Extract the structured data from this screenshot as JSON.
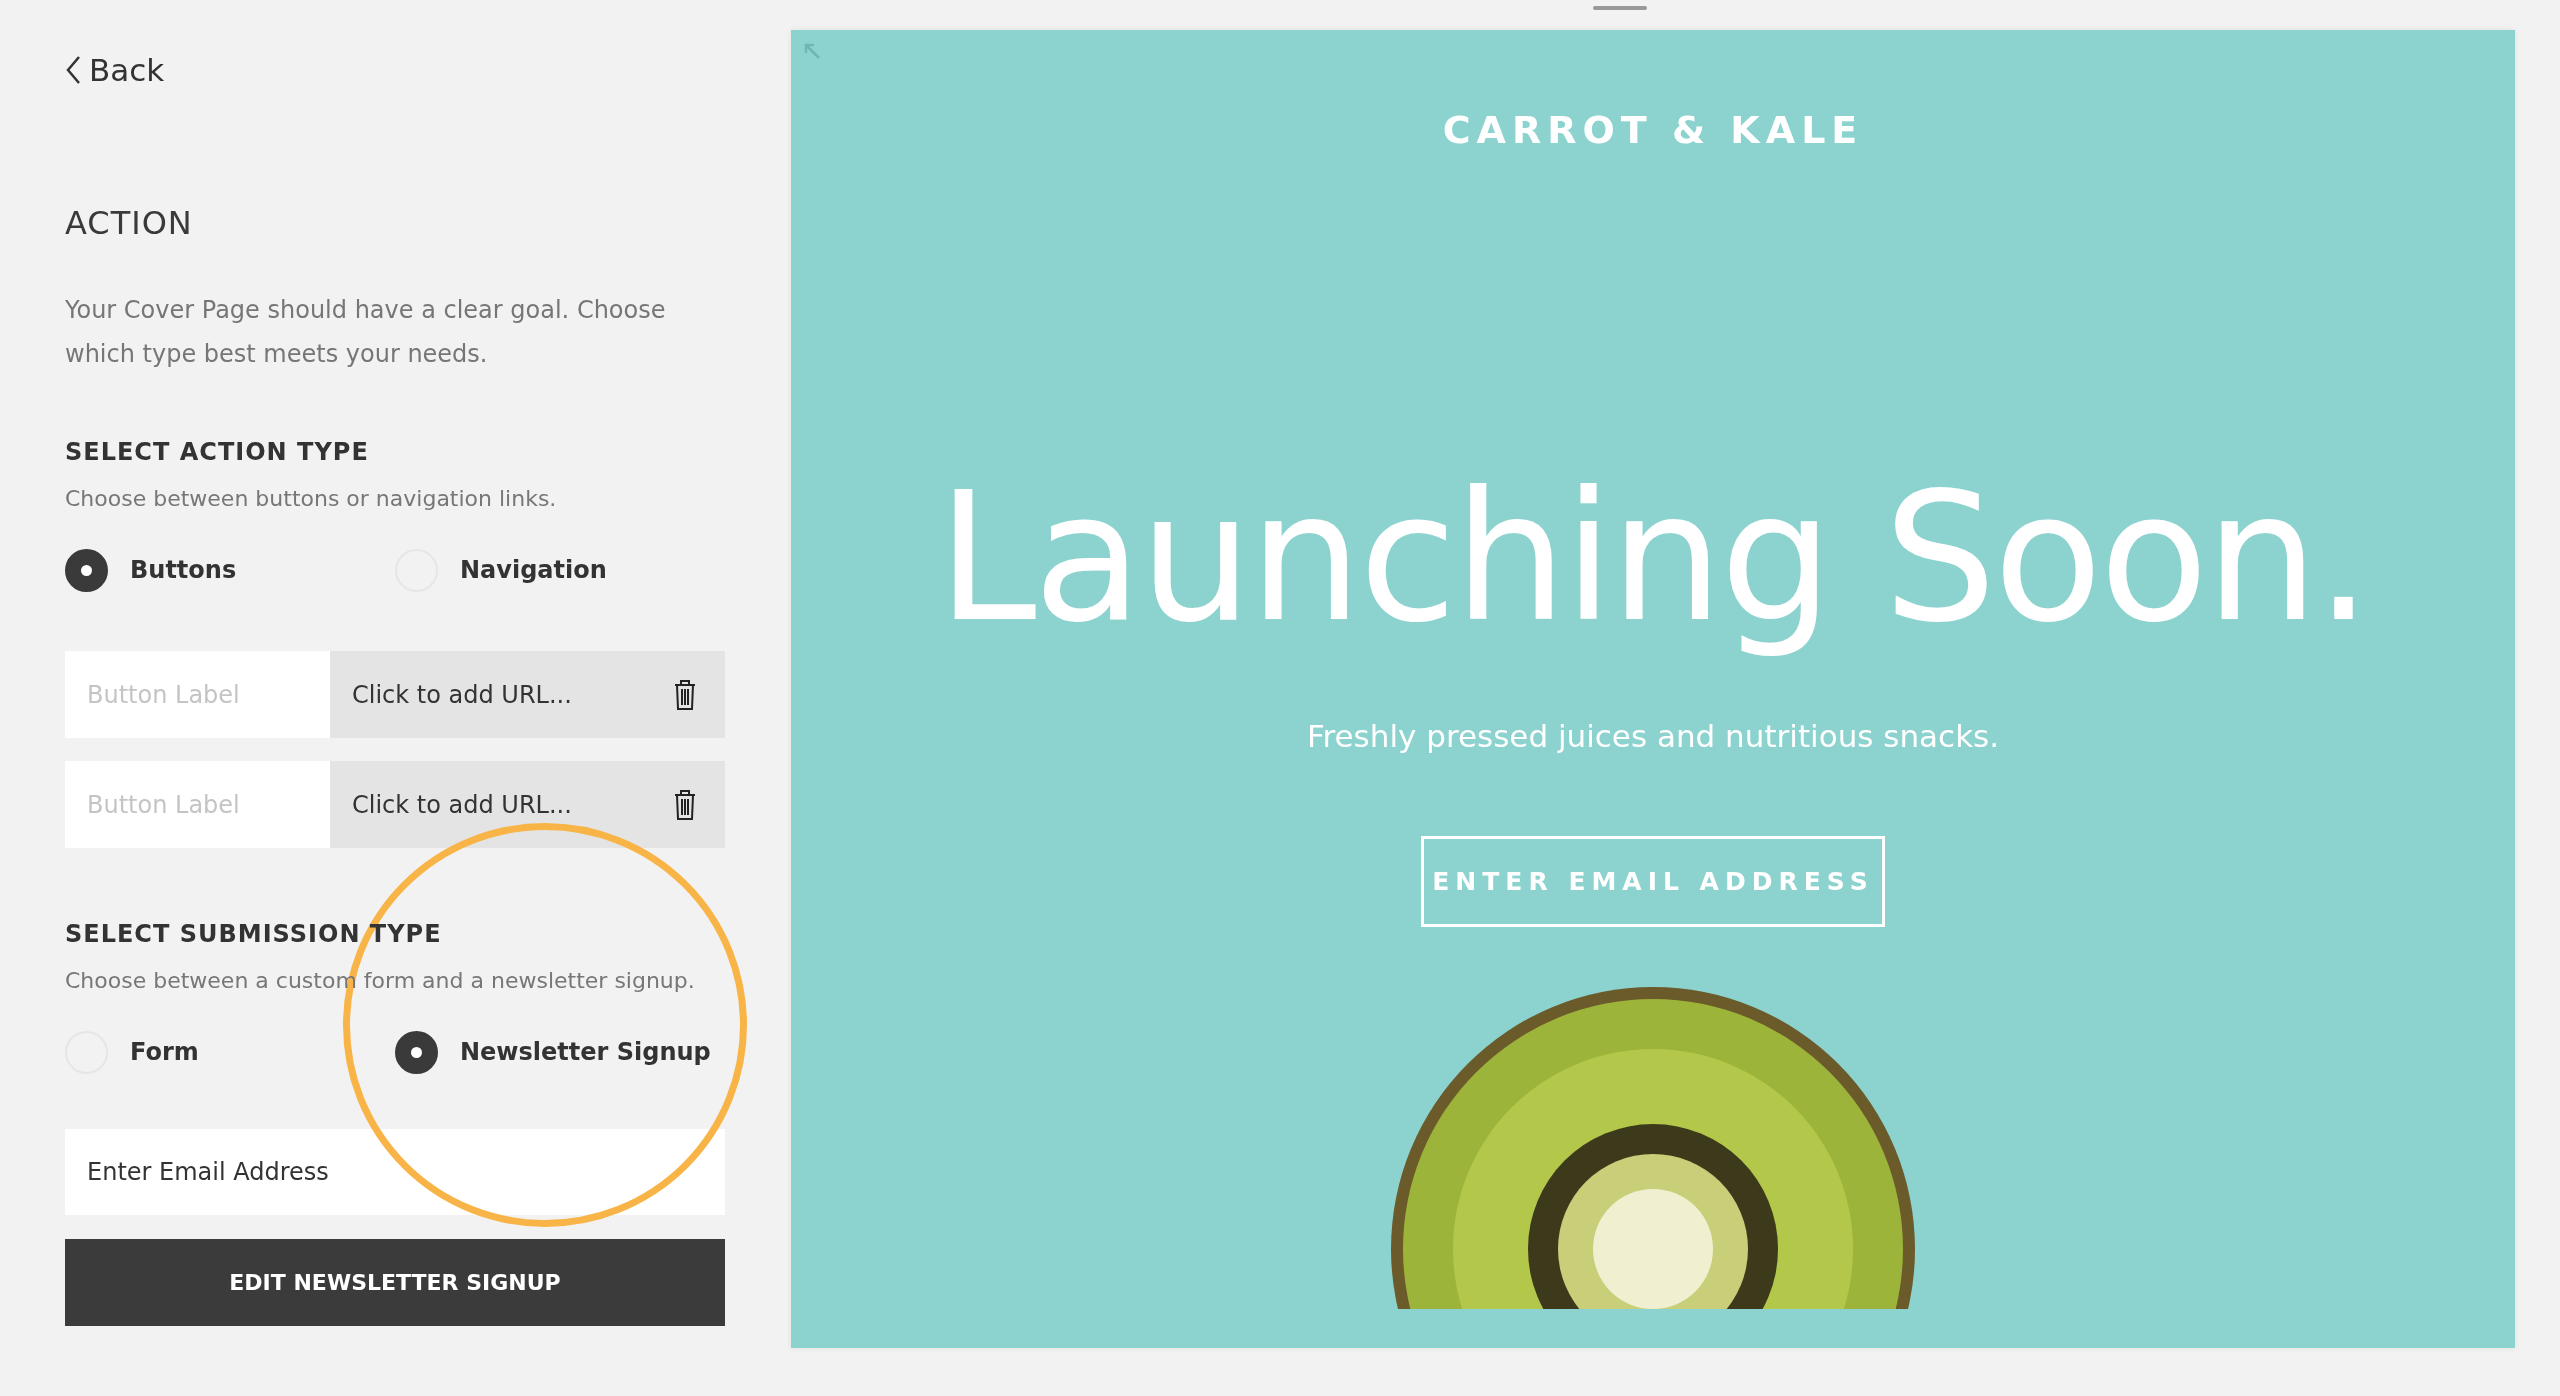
{
  "back": {
    "label": "Back"
  },
  "section": {
    "title": "ACTION",
    "description": "Your Cover Page should have a clear goal. Choose which type best meets your needs."
  },
  "action_type": {
    "title": "SELECT ACTION TYPE",
    "hint": "Choose between buttons or navigation links.",
    "options": [
      {
        "label": "Buttons",
        "selected": true
      },
      {
        "label": "Navigation",
        "selected": false
      }
    ]
  },
  "button_rows": [
    {
      "label_placeholder": "Button Label",
      "url": "Click to add URL..."
    },
    {
      "label_placeholder": "Button Label",
      "url": "Click to add URL..."
    }
  ],
  "submission_type": {
    "title": "SELECT SUBMISSION TYPE",
    "hint": "Choose between a custom form and a newsletter signup.",
    "options": [
      {
        "label": "Form",
        "selected": false
      },
      {
        "label": "Newsletter Signup",
        "selected": true
      }
    ]
  },
  "email_field": {
    "value": "Enter Email Address"
  },
  "edit_button": {
    "label": "EDIT NEWSLETTER SIGNUP"
  },
  "preview": {
    "brand": "CARROT & KALE",
    "headline": "Launching Soon.",
    "subtitle": "Freshly pressed juices and nutritious snacks.",
    "cta": "ENTER EMAIL ADDRESS"
  }
}
